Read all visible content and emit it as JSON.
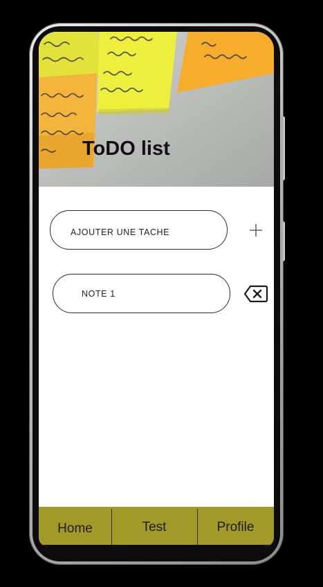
{
  "header": {
    "title": "ToDO list"
  },
  "add_task": {
    "label": "AJOUTER UNE TACHE",
    "add_icon": "plus-icon"
  },
  "tasks": [
    {
      "label": "NOTE 1",
      "delete_icon": "backspace-icon"
    }
  ],
  "tabbar": {
    "items": [
      {
        "label": "Home"
      },
      {
        "label": "Test"
      },
      {
        "label": "Profile"
      }
    ]
  },
  "colors": {
    "tabbar_background": "#a29a26",
    "sticky_yellow": "#e8e83a",
    "sticky_orange": "#f4b231"
  }
}
